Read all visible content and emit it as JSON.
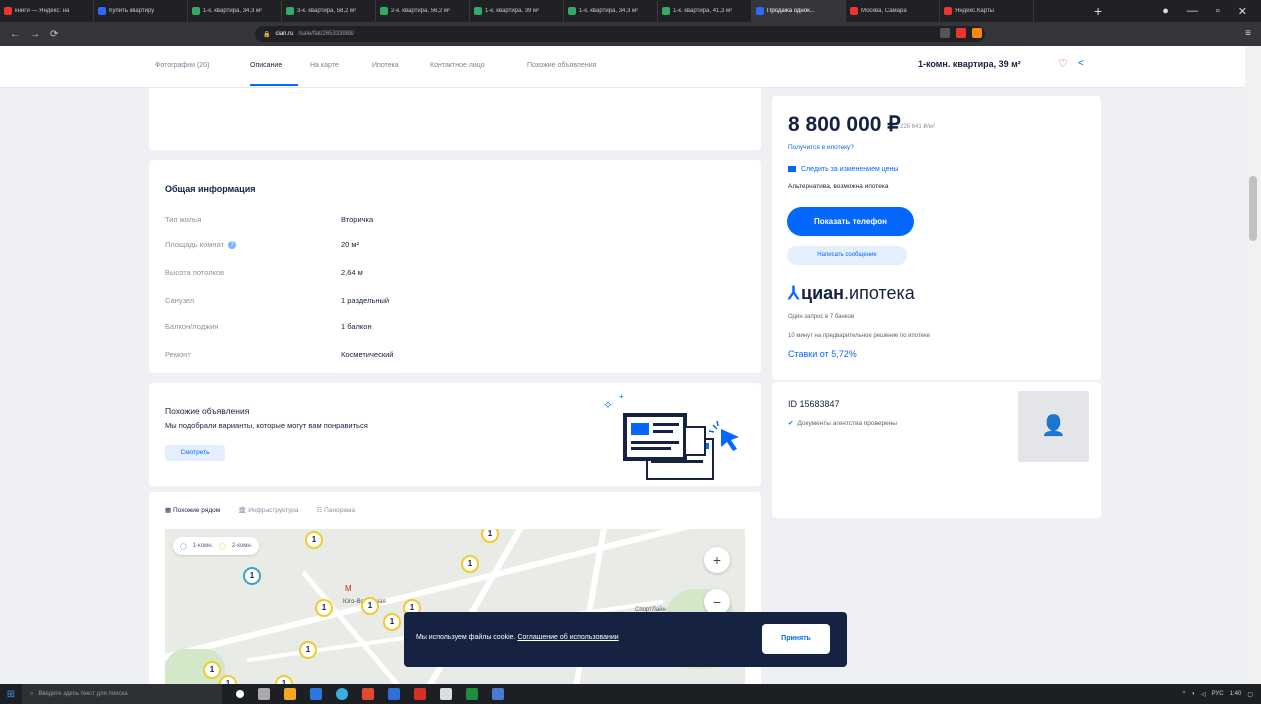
{
  "browser": {
    "tabs": [
      {
        "label": "книги — Яндекс: на",
        "color": "#e33"
      },
      {
        "label": "Купить квартиру",
        "color": "#36f"
      },
      {
        "label": "1-к. квартира, 34,3 м²",
        "color": "#3a6"
      },
      {
        "label": "3-к. квартира, 58,2 м²",
        "color": "#3a6"
      },
      {
        "label": "2-к. квартира, 56,2 м²",
        "color": "#3a6"
      },
      {
        "label": "1-к. квартира, 39 м²",
        "color": "#3a6"
      },
      {
        "label": "1-к. квартира, 34,3 м²",
        "color": "#3a6"
      },
      {
        "label": "1-к. квартира, 41,3 м²",
        "color": "#3a6"
      },
      {
        "label": "Продажа однок...",
        "color": "#36f",
        "active": true
      },
      {
        "label": "Москва, Самара",
        "color": "#e33"
      },
      {
        "label": "Яндекс.Карты",
        "color": "#e33"
      }
    ],
    "url_host": "cian.ru",
    "url_path": "/sale/flat/265333988/"
  },
  "nav": {
    "items": [
      "Фотографии (20)",
      "Описание",
      "На карте",
      "Ипотека",
      "Контактное лицо",
      "Похожие объявления"
    ],
    "title": "1-комн. квартира, 39 м²"
  },
  "info": {
    "title": "Общая информация",
    "rows": [
      {
        "label": "Тип жилья",
        "value": "Вторичка"
      },
      {
        "label": "Площадь комнат",
        "value": "20 м²"
      },
      {
        "label": "Высота потолков",
        "value": "2,64 м"
      },
      {
        "label": "Санузел",
        "value": "1 раздельный"
      },
      {
        "label": "Балкон/лоджия",
        "value": "1 балкон"
      },
      {
        "label": "Ремонт",
        "value": "Косметический"
      }
    ]
  },
  "similar": {
    "title": "Похожие объявления",
    "text": "Мы подобрали варианты, которые могут вам понравиться",
    "button": "Смотреть"
  },
  "map": {
    "tabs": [
      "Похожие рядом",
      "Инфраструктура",
      "Панорама"
    ],
    "legend": [
      "1-комн.",
      "2-комн."
    ],
    "labels": [
      "Юго-Восточная",
      "СпортЛайн"
    ],
    "pins": [
      "1",
      "1",
      "1",
      "1",
      "1",
      "1",
      "1",
      "1",
      "1",
      "1",
      "1",
      "1",
      "1",
      "1",
      "1"
    ]
  },
  "offer": {
    "price": "8 800 000 ₽",
    "per_meter": "225 641 ₽/м²",
    "mortgage_question": "Получится в ипотеку?",
    "price_watch": "Следить за изменением цены",
    "alt_mortgage": "Альтернатива, возможна ипотека",
    "phone_button": "Показать телефон",
    "message_button": "Написать сообщение",
    "cian_bold": "циан",
    "cian_light": ".ипотека",
    "mortgage_line1": "Один запрос в 7 банков",
    "mortgage_line2": "10 минут на предварительное решение по ипотеке",
    "rates": "Ставки от 5,72%"
  },
  "agent": {
    "id": "ID 15683847",
    "docs": "Документы агентства проверены"
  },
  "cookie": {
    "text": "Мы используем файлы cookie.",
    "link": "Соглашение об использовании",
    "button": "Принять"
  },
  "taskbar": {
    "search": "Введите здесь текст для поиска",
    "time": "1:40",
    "lang": "РУС"
  },
  "colors": {
    "brand_blue": "#0468ff",
    "dark": "#152242",
    "pin_yellow": "#f0cc2a"
  }
}
